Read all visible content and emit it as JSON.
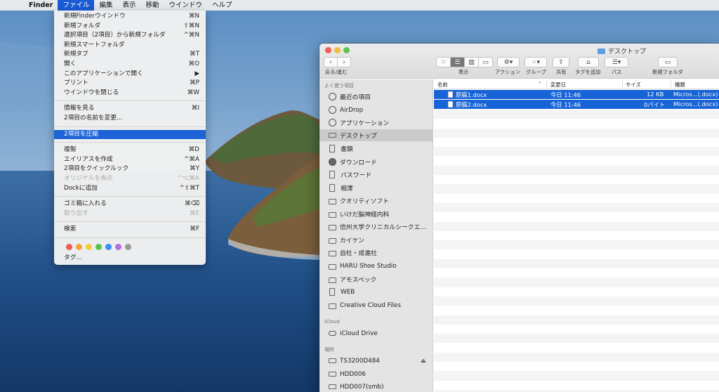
{
  "menubar": {
    "apple": "",
    "items": [
      "Finder",
      "ファイル",
      "編集",
      "表示",
      "移動",
      "ウインドウ",
      "ヘルプ"
    ]
  },
  "file_menu": {
    "group1": [
      {
        "label": "新規Finderウインドウ",
        "shortcut": "⌘N"
      },
      {
        "label": "新規フォルダ",
        "shortcut": "⇧⌘N"
      },
      {
        "label": "選択項目（2項目）から新規フォルダ",
        "shortcut": "^⌘N"
      },
      {
        "label": "新規スマートフォルダ",
        "shortcut": ""
      },
      {
        "label": "新規タブ",
        "shortcut": "⌘T"
      },
      {
        "label": "開く",
        "shortcut": "⌘O"
      },
      {
        "label": "このアプリケーションで開く",
        "shortcut": "▶"
      },
      {
        "label": "プリント",
        "shortcut": "⌘P"
      },
      {
        "label": "ウインドウを閉じる",
        "shortcut": "⌘W"
      }
    ],
    "group2": [
      {
        "label": "情報を見る",
        "shortcut": "⌘I"
      },
      {
        "label": "2項目の名前を変更...",
        "shortcut": ""
      }
    ],
    "compress": "2項目を圧縮",
    "group3": [
      {
        "label": "複製",
        "shortcut": "⌘D"
      },
      {
        "label": "エイリアスを作成",
        "shortcut": "^⌘A"
      },
      {
        "label": "2項目をクイックルック",
        "shortcut": "⌘Y"
      },
      {
        "label": "オリジナルを表示",
        "shortcut": "^⌥⌘A"
      },
      {
        "label": "Dockに追加",
        "shortcut": "^⇧⌘T"
      }
    ],
    "group4": [
      {
        "label": "ゴミ箱に入れる",
        "shortcut": "⌘⌫"
      },
      {
        "label": "取り出す",
        "shortcut": "⌘E"
      }
    ],
    "search": {
      "label": "検索",
      "shortcut": "⌘F"
    },
    "tag_colors": [
      "#ec5b57",
      "#f5a43a",
      "#f4cc3b",
      "#5cc24f",
      "#3b8ff4",
      "#b46ee0",
      "#9a9a9a"
    ],
    "tags_label": "タグ..."
  },
  "finder": {
    "title": "デスクトップ",
    "toolbar": {
      "back_label": "戻る/進む",
      "view_label": "表示",
      "action_label": "アクション",
      "group_label": "グループ",
      "share_label": "共有",
      "tag_label": "タグを追加",
      "path_label": "パス",
      "newfolder_label": "新規フォルダ"
    },
    "sidebar": {
      "favorites_header": "よく使う項目",
      "favorites": [
        "最近の項目",
        "AirDrop",
        "アプリケーション",
        "デスクトップ",
        "書類",
        "ダウンロード",
        "パスワード",
        "相澤",
        "クオリティソフト",
        "いけだ脳神経内科",
        "信州大学クリニカルシークエ...",
        "カイケン",
        "自社・成進社",
        "HARU Shoe Studio",
        "アモスペック",
        "WEB",
        "Creative Cloud Files"
      ],
      "icloud_header": "iCloud",
      "icloud": [
        "iCloud Drive"
      ],
      "places_header": "場所",
      "places": [
        "TS3200D484",
        "HDD006",
        "HDD007(smb)"
      ],
      "eject": "⏏"
    },
    "columns": {
      "name": "名前",
      "modified": "変更日",
      "size": "サイズ",
      "kind": "種類"
    },
    "files": [
      {
        "name": "原稿1.docx",
        "modified": "今日 11:46",
        "size": "12 KB",
        "kind": "Micros...(.docx)"
      },
      {
        "name": "原稿2.docx",
        "modified": "今日 11:46",
        "size": "0バイト",
        "kind": "Micros...(.docx)"
      }
    ]
  }
}
